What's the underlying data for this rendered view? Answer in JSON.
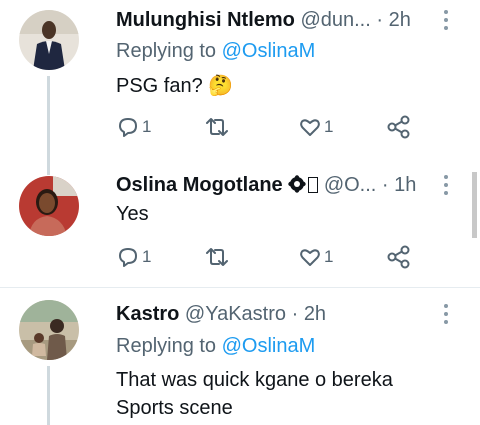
{
  "tweets": [
    {
      "name": "Mulunghisi Ntlemo",
      "handle": "@dun...",
      "sep": "·",
      "time": "2h",
      "replying_prefix": "Replying to ",
      "replying_to": "@OslinaM",
      "text": "PSG fan? 🤔",
      "replies": "1",
      "retweets": "",
      "likes": "1"
    },
    {
      "name": "Oslina Mogotlane",
      "handle": "@O...",
      "sep": "·",
      "time": "1h",
      "text": "Yes",
      "replies": "1",
      "retweets": "",
      "likes": "1"
    },
    {
      "name": "Kastro",
      "handle": "@YaKastro",
      "sep": "·",
      "time": "2h",
      "replying_prefix": "Replying to ",
      "replying_to": "@OslinaM",
      "text_line1": "That was quick kgane o bereka",
      "text_line2": "Sports scene"
    }
  ],
  "colors": {
    "accent": "#1d9bf0",
    "muted": "#536471",
    "text": "#0f1419",
    "thread_line": "#cfd9de"
  },
  "icons": [
    "reply-icon",
    "retweet-icon",
    "like-icon",
    "share-icon",
    "more-icon",
    "verified-icon"
  ]
}
